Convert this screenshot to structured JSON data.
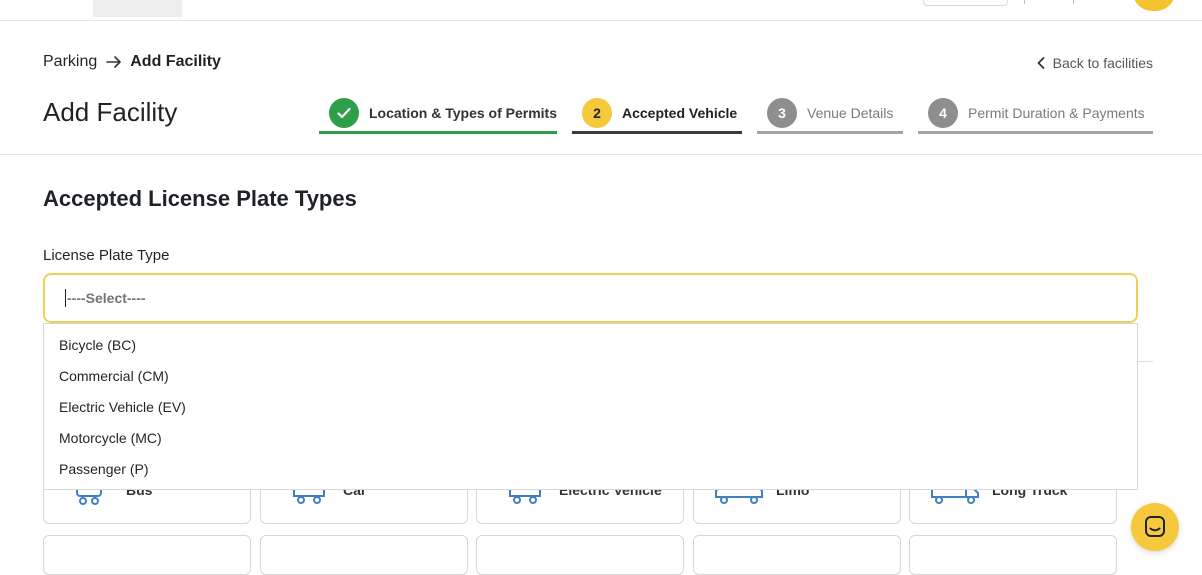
{
  "breadcrumb": {
    "parent": "Parking",
    "current": "Add Facility"
  },
  "back_link": "Back to facilities",
  "page_title": "Add Facility",
  "steps": [
    {
      "number": "",
      "label": "Location & Types of Permits",
      "state": "done"
    },
    {
      "number": "2",
      "label": "Accepted Vehicle",
      "state": "active"
    },
    {
      "number": "3",
      "label": "Venue Details",
      "state": "upcoming"
    },
    {
      "number": "4",
      "label": "Permit Duration & Payments",
      "state": "upcoming"
    }
  ],
  "section_title": "Accepted License Plate Types",
  "license_plate": {
    "label": "License Plate Type",
    "selected": "----Select----",
    "options": [
      "Bicycle (BC)",
      "Commercial (CM)",
      "Electric Vehicle (EV)",
      "Motorcycle (MC)",
      "Passenger (P)"
    ]
  },
  "vehicle_cards": [
    {
      "label": "Bus",
      "icon": "bus-icon"
    },
    {
      "label": "Car",
      "icon": "car-icon"
    },
    {
      "label": "Electric Vehicle",
      "icon": "electric-vehicle-icon"
    },
    {
      "label": "Limo",
      "icon": "limo-icon"
    },
    {
      "label": "Long Truck",
      "icon": "long-truck-icon"
    }
  ],
  "colors": {
    "accent_yellow": "#f5c93b",
    "done_green": "#2e9e48",
    "vehicle_icon_blue": "#3f7fc4"
  }
}
